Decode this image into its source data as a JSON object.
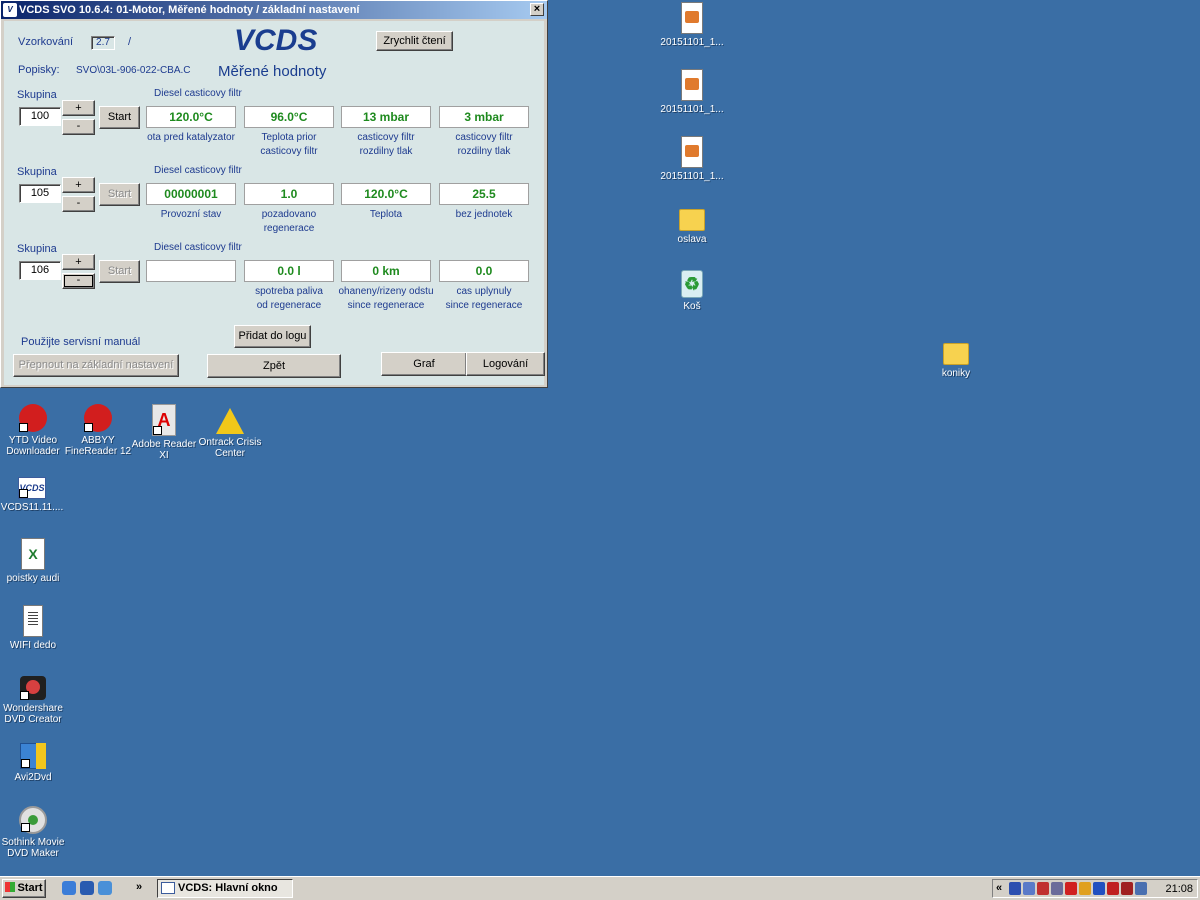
{
  "window": {
    "title": "VCDS SVO 10.6.4: 01-Motor,  Měřené hodnoty / základní nastavení",
    "close_label": "×",
    "sampling_label": "Vzorkování",
    "sampling_value": "2.7",
    "sampling_sep": "/",
    "labels_label": "Popisky:",
    "labels_value": "SVO\\03L-906-022-CBA.C",
    "logo": "VCDS",
    "subtitle": "Měřené hodnoty",
    "speed_button": "Zrychlit čtení",
    "groups": [
      {
        "label": "Skupina",
        "number": "100",
        "title": "Diesel casticovy filtr",
        "start": "Start",
        "start_enabled": true,
        "plus": "+",
        "minus": "-",
        "values": [
          "120.0°C",
          "96.0°C",
          "13 mbar",
          "3 mbar"
        ],
        "captions": [
          [
            "ota pred katalyzator",
            ""
          ],
          [
            "Teplota prior",
            "casticovy filtr"
          ],
          [
            "casticovy filtr",
            "rozdilny tlak"
          ],
          [
            "casticovy filtr",
            "rozdilny tlak"
          ]
        ]
      },
      {
        "label": "Skupina",
        "number": "105",
        "title": "Diesel casticovy filtr",
        "start": "Start",
        "start_enabled": false,
        "plus": "+",
        "minus": "-",
        "values": [
          "00000001",
          "1.0",
          "120.0°C",
          "25.5"
        ],
        "captions": [
          [
            "Provozní stav",
            ""
          ],
          [
            "pozadovano",
            "regenerace"
          ],
          [
            "Teplota",
            ""
          ],
          [
            "bez jednotek",
            ""
          ]
        ]
      },
      {
        "label": "Skupina",
        "number": "106",
        "title": "Diesel casticovy filtr",
        "start": "Start",
        "start_enabled": false,
        "plus": "+",
        "minus": "-",
        "values": [
          "",
          "0.0 l",
          "0 km",
          "0.0"
        ],
        "captions": [
          [
            "",
            ""
          ],
          [
            "spotreba paliva",
            "od regenerace"
          ],
          [
            "ohaneny/rizeny odstu",
            "since regenerace"
          ],
          [
            "cas uplynuly",
            "since regenerace"
          ]
        ]
      }
    ],
    "manual_text": "Použijte servisní manuál",
    "add_log_button": "Přidat do logu",
    "switch_button": "Přepnout na základní nastavení",
    "back_button": "Zpět",
    "graph_button": "Graf",
    "logging_button": "Logování"
  },
  "desktop_icons_right": [
    {
      "label": "20151101_1...",
      "icon": "image-file-icon"
    },
    {
      "label": "20151101_1...",
      "icon": "image-file-icon"
    },
    {
      "label": "20151101_1...",
      "icon": "image-file-icon"
    },
    {
      "label": "oslava",
      "icon": "folder-icon"
    },
    {
      "label": "Koš",
      "icon": "recycle-bin-icon"
    }
  ],
  "desktop_icon_koniky": {
    "label": "koniky",
    "icon": "folder-icon"
  },
  "desktop_icons_row": [
    {
      "label": "YTD Video Downloader",
      "icon": "ytd-icon"
    },
    {
      "label": "ABBYY FineReader 12",
      "icon": "abbyy-icon"
    },
    {
      "label": "Adobe Reader XI",
      "icon": "adobe-reader-icon"
    },
    {
      "label": "Ontrack Crisis Center",
      "icon": "ontrack-icon"
    }
  ],
  "desktop_icons_left": [
    {
      "label": "VCDS11.11....",
      "icon": "vcds-icon"
    },
    {
      "label": "poistky audi",
      "icon": "excel-file-icon"
    },
    {
      "label": "WIFI dedo",
      "icon": "text-file-icon"
    },
    {
      "label": "Wondershare DVD Creator",
      "icon": "dvd-creator-icon"
    },
    {
      "label": "Avi2Dvd",
      "icon": "avi2dvd-icon"
    },
    {
      "label": "Sothink Movie DVD Maker",
      "icon": "sothink-icon"
    }
  ],
  "taskbar": {
    "start_label": "Start",
    "chevron": "»",
    "task_label": "VCDS:  Hlavní okno",
    "tray_chevron": "«",
    "clock": "21:08"
  },
  "colors": {
    "desktop": "#3a6ea5",
    "title_gradient_start": "#0a246a",
    "value_green": "#1e8a1e",
    "label_blue": "#1d3a8f"
  }
}
